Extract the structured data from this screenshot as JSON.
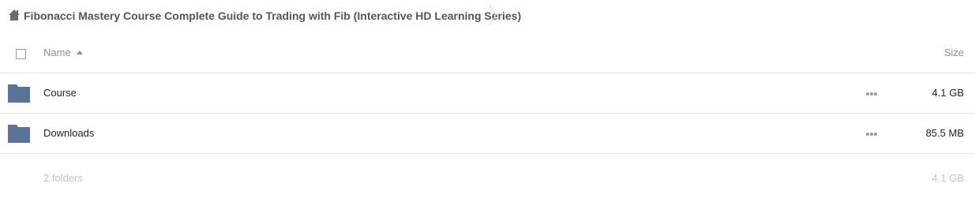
{
  "breadcrumb": {
    "home_icon": "home-icon",
    "current": "Fibonacci Mastery Course Complete Guide to Trading with Fib (Interactive HD Learning Series)"
  },
  "table": {
    "columns": {
      "name": "Name",
      "size": "Size"
    },
    "sort": {
      "column": "name",
      "direction": "ascending"
    },
    "rows": [
      {
        "icon": "folder-icon",
        "name": "Course",
        "size": "4.1 GB"
      },
      {
        "icon": "folder-icon",
        "name": "Downloads",
        "size": "85.5 MB"
      }
    ]
  },
  "footer": {
    "count": "2 folders",
    "total_size": "4.1 GB"
  },
  "colors": {
    "folder": "#5a7399",
    "header_text": "#8e8e8e",
    "footer_text": "#c2c2c2",
    "border": "#e4e4e4"
  }
}
